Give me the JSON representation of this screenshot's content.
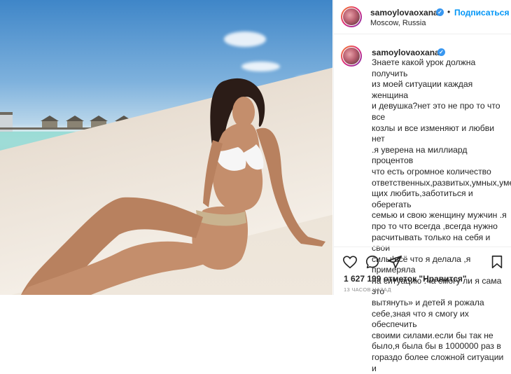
{
  "post": {
    "username": "samoylovaoxana",
    "verified_symbol": "✓",
    "separator": "•",
    "follow_label": "Подписаться",
    "location": "Moscow, Russia",
    "caption": "Знаете какой урок должна получить\nиз моей ситуации каждая женщина\nи девушка?нет это не про то что все\nкозлы и все изменяют и любви нет\n.я уверена на миллиард процентов\nчто есть огромное количество\nответственных,развитых,умных,умею\nщих любить,заботиться и оберегать\nсемью и свою женщину мужчин .я\nпро то что всегда ,всегда нужно\nрасчитывать только на себя и свои\nсилы!всё что я делала ,я примеряла\nна ситуацию :«а смогу ли я сама это\nвытянуть» и детей я рожала\nсебе,зная что я смогу их обеспечить\nсвоими силами.если бы так не\nбыло,я была бы в 1000000 раз в\nгораздо более сложной ситуации и",
    "likes": "1 627 199 отметок \"Нравится\"",
    "timestamp": "13 ЧАСОВ НАЗАД"
  },
  "icons": {
    "like": "heart-icon",
    "comment": "comment-icon",
    "share": "share-icon",
    "save": "bookmark-icon",
    "verified": "verified-badge-icon"
  },
  "colors": {
    "follow": "#0095f6",
    "verified": "#3897f0",
    "text": "#262626",
    "muted": "#8e8e8e"
  }
}
